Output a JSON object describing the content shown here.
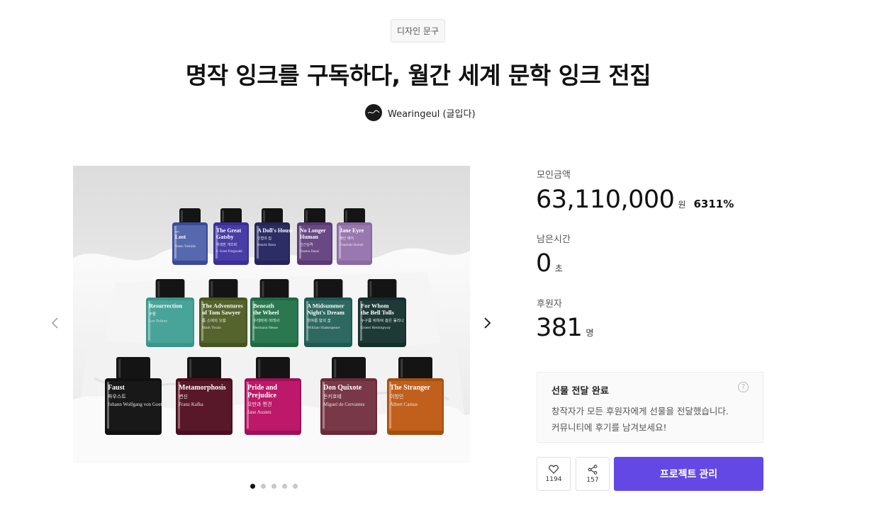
{
  "category": "디자인 문구",
  "title": "명작 잉크를 구독하다, 월간 세계 문학 잉크 전집",
  "creator": {
    "name": "Wearingeul (글입다)"
  },
  "gallery": {
    "slide_count": 5,
    "active_slide": 0,
    "bottles": [
      {
        "row": 0,
        "title_lines": [
          "...",
          "Lost"
        ],
        "author": "Natsu Yoshida",
        "color": "#5a6cb0",
        "liquid": "#3a4a96"
      },
      {
        "row": 0,
        "title_lines": [
          "The Great",
          "Gatsby"
        ],
        "sub": "위대한 개츠비",
        "author": "F. Scott Fitzgerald",
        "color": "#4a3fa8",
        "liquid": "#3a2f98"
      },
      {
        "row": 0,
        "title_lines": [
          "A Doll's House"
        ],
        "sub": "인형의 집",
        "author": "Henrik Ibsen",
        "color": "#2f2f68",
        "liquid": "#252558"
      },
      {
        "row": 0,
        "title_lines": [
          "No Longer",
          "Human"
        ],
        "sub": "인간실격",
        "author": "Osamu Dazai",
        "color": "#6a4a86",
        "liquid": "#5a3a76"
      },
      {
        "row": 0,
        "title_lines": [
          "Jane Eyre"
        ],
        "sub": "제인 에어",
        "author": "Charlotte Bronte",
        "color": "#9a7ab0",
        "liquid": "#8a6aa0"
      },
      {
        "row": 1,
        "title_lines": [
          "Resurrection"
        ],
        "sub": "부활",
        "author": "Leo Tolstoy",
        "color": "#4aa59a",
        "liquid": "#3a958a"
      },
      {
        "row": 1,
        "title_lines": [
          "The Adventures",
          "of Tom Sawyer"
        ],
        "sub": "톰 소여의 모험",
        "author": "Mark Twain",
        "color": "#56652f",
        "liquid": "#46551f"
      },
      {
        "row": 1,
        "title_lines": [
          "Beneath",
          "the Wheel"
        ],
        "sub": "수레바퀴 아래서",
        "author": "Hermann Hesse",
        "color": "#2d7a52",
        "liquid": "#1d6a42"
      },
      {
        "row": 1,
        "title_lines": [
          "A Midsummer",
          "Night's Dream"
        ],
        "sub": "한여름 밤의 꿈",
        "author": "William Shakespeare",
        "color": "#2f6a62",
        "liquid": "#1f5a52"
      },
      {
        "row": 1,
        "title_lines": [
          "For Whom",
          "the Bell Tolls"
        ],
        "sub": "누구를 위하여 종은 울리나",
        "author": "Ernest Hemingway",
        "color": "#1f3c38",
        "liquid": "#152e2a"
      },
      {
        "row": 2,
        "title_lines": [
          "Faust"
        ],
        "sub": "파우스트",
        "author": "Johann Wolfgang von Goethe",
        "color": "#1a1a1a",
        "liquid": "#111111"
      },
      {
        "row": 2,
        "title_lines": [
          "Metamorphosis"
        ],
        "sub": "변신",
        "author": "Franz Kafka",
        "color": "#5a1a2a",
        "liquid": "#4a0f1f"
      },
      {
        "row": 2,
        "title_lines": [
          "Pride and",
          "Prejudice"
        ],
        "sub": "오만과 편견",
        "author": "Jane Austen",
        "color": "#c01a6a",
        "liquid": "#a00f5a"
      },
      {
        "row": 2,
        "title_lines": [
          "Don Quixote"
        ],
        "sub": "돈키호테",
        "author": "Miguel de Cervantes",
        "color": "#7a3a4a",
        "liquid": "#6a2a3a"
      },
      {
        "row": 2,
        "title_lines": [
          "The Stranger"
        ],
        "sub": "이방인",
        "author": "Albert Camus",
        "color": "#c4601f",
        "liquid": "#a4500f"
      }
    ]
  },
  "stats": {
    "funding_label": "모인금액",
    "funding_amount": "63,110,000",
    "funding_unit": "원",
    "funding_percent": "6311%",
    "time_label": "남은시간",
    "time_value": "0",
    "time_unit": "초",
    "backers_label": "후원자",
    "backers_value": "381",
    "backers_unit": "명"
  },
  "delivery": {
    "title": "선물 전달 완료",
    "line1": "창작자가 모든 후원자에게 선물을 전달했습니다.",
    "line2": "커뮤니티에 후기를 남겨보세요!",
    "help": "?"
  },
  "actions": {
    "like_count": "1194",
    "share_count": "157",
    "manage_label": "프로젝트 관리"
  },
  "colors": {
    "accent": "#6448e6"
  }
}
